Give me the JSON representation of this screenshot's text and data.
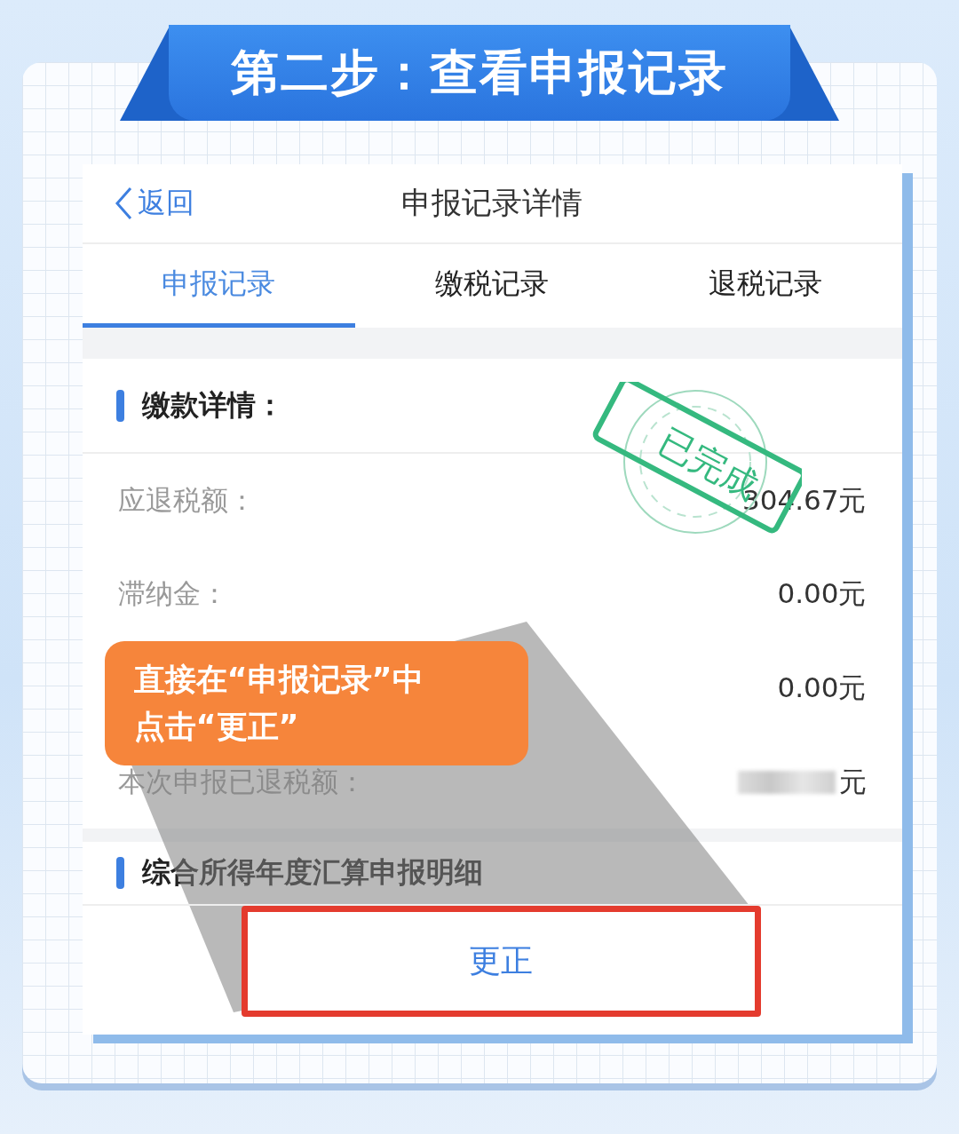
{
  "banner": {
    "title": "第二步：查看申报记录"
  },
  "screen": {
    "back_label": "返回",
    "title": "申报记录详情",
    "tabs": [
      {
        "label": "申报记录",
        "selected": true
      },
      {
        "label": "缴税记录",
        "selected": false
      },
      {
        "label": "退税记录",
        "selected": false
      }
    ],
    "payment_section": {
      "heading": "缴款详情：",
      "rows": [
        {
          "kind": "amount",
          "label": "应退税额：",
          "value": "304.67元"
        },
        {
          "kind": "amount",
          "label": "滞纳金：",
          "value": "0.00元"
        },
        {
          "kind": "amount",
          "value": "0.00元"
        },
        {
          "kind": "blurred",
          "label": "本次申报已退税额：",
          "value": "元"
        }
      ]
    },
    "detail_section": {
      "heading": "综合所得年度汇算申报明细"
    },
    "stamp": {
      "text": "已完成"
    },
    "button": {
      "label": "更正",
      "highlighted": true
    }
  },
  "callout": {
    "lines": [
      "直接在“申报记录”中",
      "点击“更正”"
    ]
  }
}
